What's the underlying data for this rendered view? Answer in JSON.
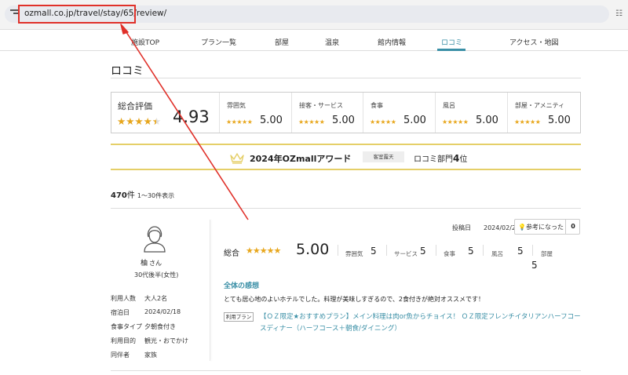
{
  "browser": {
    "url": "ozmall.co.jp/travel/stay/65/review/"
  },
  "nav": {
    "items": [
      {
        "label": "施設TOP"
      },
      {
        "label": "プラン一覧"
      },
      {
        "label": "部屋"
      },
      {
        "label": "温泉"
      },
      {
        "label": "館内情報"
      },
      {
        "label": "ロコミ",
        "active": true
      },
      {
        "label": "アクセス・地図"
      }
    ]
  },
  "page": {
    "title": "ロコミ"
  },
  "rating": {
    "overall_label": "総合評価",
    "overall_score": "4.93",
    "overall_stars_value": 4.5,
    "stars_glyph": "★★★★★",
    "categories": [
      {
        "label": "雰囲気",
        "score": "5.00"
      },
      {
        "label": "接客・サービス",
        "score": "5.00"
      },
      {
        "label": "食事",
        "score": "5.00"
      },
      {
        "label": "風呂",
        "score": "5.00"
      },
      {
        "label": "部屋・アメニティ",
        "score": "5.00"
      }
    ]
  },
  "award": {
    "title": "2024年OZmallアワード",
    "badge": "客室露天",
    "rank_prefix": "ロコミ部門",
    "rank_num": "4",
    "rank_suffix": "位"
  },
  "listing": {
    "count": "470",
    "count_unit": "件",
    "range": "1〜30件表示"
  },
  "review": {
    "reviewer_name": "柚",
    "reviewer_suffix": "さん",
    "reviewer_age": "30代後半(女性)",
    "meta": [
      {
        "key": "利用人数",
        "value": "大人2名"
      },
      {
        "key": "宿泊日",
        "value": "2024/02/18"
      },
      {
        "key": "食事タイプ",
        "value": "夕朝食付き"
      },
      {
        "key": "利用目的",
        "value": "観光・おでかけ"
      },
      {
        "key": "同伴者",
        "value": "家族"
      }
    ],
    "post_date_label": "投稿日",
    "post_date": "2024/02/21",
    "helpful_label": "参考になった",
    "helpful_count": "0",
    "overall_label": "総合",
    "overall_stars": "★★★★★",
    "overall_score": "5.00",
    "sub_scores": [
      {
        "label": "雰囲気",
        "value": "5"
      },
      {
        "label": "サービス",
        "value": "5"
      },
      {
        "label": "食事",
        "value": "5"
      },
      {
        "label": "風呂",
        "value": "5"
      },
      {
        "label": "部屋",
        "value": "5"
      }
    ],
    "impression_title": "全体の感想",
    "impression_body": "とても居心地のよいホテルでした。料理が美味しすぎるので、2食付きが絶対オススメです！",
    "plan_badge": "利用プラン",
    "plan_link": "【ＯＺ限定★おすすめプラン】メイン料理は肉or魚からチョイス！ ＯＺ限定フレンチイタリアンハーフコースディナー（ハーフコース＋朝食/ダイニング）"
  },
  "colors": {
    "accent": "#3a8fa6",
    "star": "#e8a71d",
    "award_line": "#e5cf68",
    "annotation": "#e0312a"
  }
}
